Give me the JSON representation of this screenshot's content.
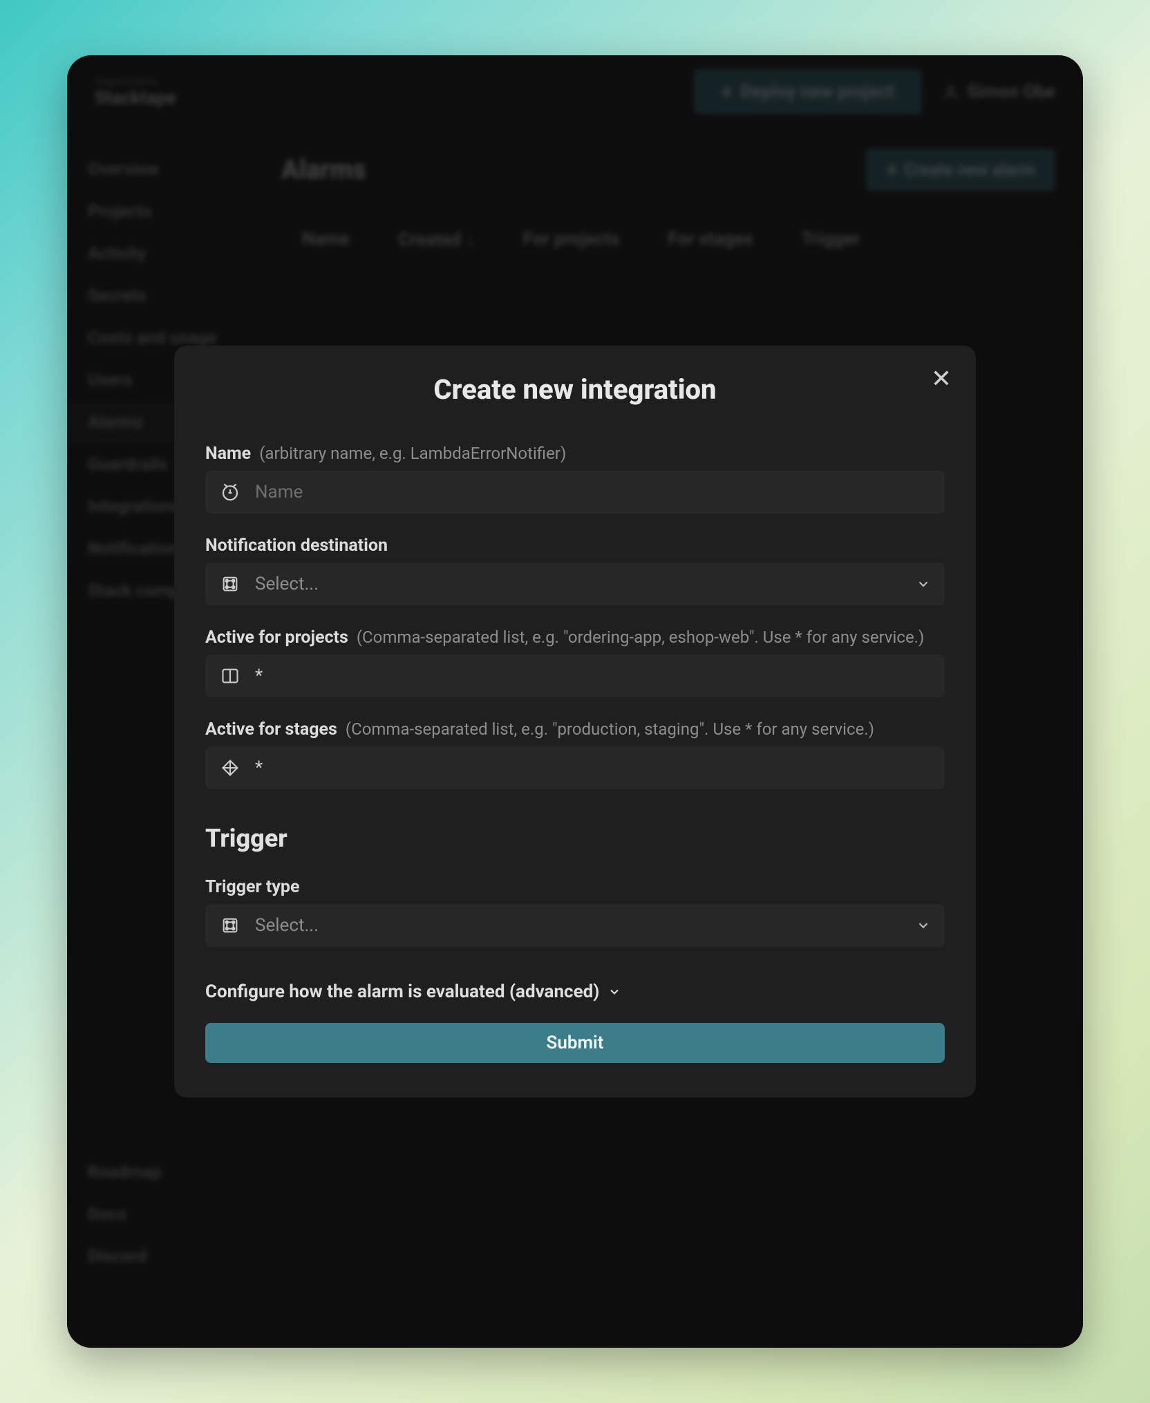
{
  "header": {
    "org_label": "Organization",
    "org_name": "Stacktape",
    "deploy_label": "Deploy new project",
    "user_name": "Simon Obe"
  },
  "sidebar": {
    "items": [
      "Overview",
      "Projects",
      "Activity",
      "Secrets",
      "Costs and usage",
      "Users",
      "Alarms",
      "Guardrails",
      "Integrations",
      "Notifications",
      "Stack composer"
    ],
    "footer": [
      "Roadmap",
      "Docs",
      "Discord"
    ]
  },
  "page": {
    "title": "Alarms",
    "create_label": "Create new alarm",
    "columns": [
      "Name",
      "Created ↓",
      "For projects",
      "For stages",
      "Trigger"
    ]
  },
  "modal": {
    "title": "Create new integration",
    "fields": {
      "name": {
        "label": "Name",
        "hint": "(arbitrary name, e.g. LambdaErrorNotifier)",
        "placeholder": "Name",
        "value": ""
      },
      "destination": {
        "label": "Notification destination",
        "placeholder": "Select..."
      },
      "projects": {
        "label": "Active for projects",
        "hint": "(Comma-separated list, e.g. \"ordering-app, eshop-web\". Use * for any service.)",
        "value": "*"
      },
      "stages": {
        "label": "Active for stages",
        "hint": "(Comma-separated list, e.g. \"production, staging\". Use * for any service.)",
        "value": "*"
      }
    },
    "trigger": {
      "section_title": "Trigger",
      "type_label": "Trigger type",
      "type_placeholder": "Select..."
    },
    "advanced_label": "Configure how the alarm is evaluated (advanced)",
    "submit_label": "Submit"
  }
}
